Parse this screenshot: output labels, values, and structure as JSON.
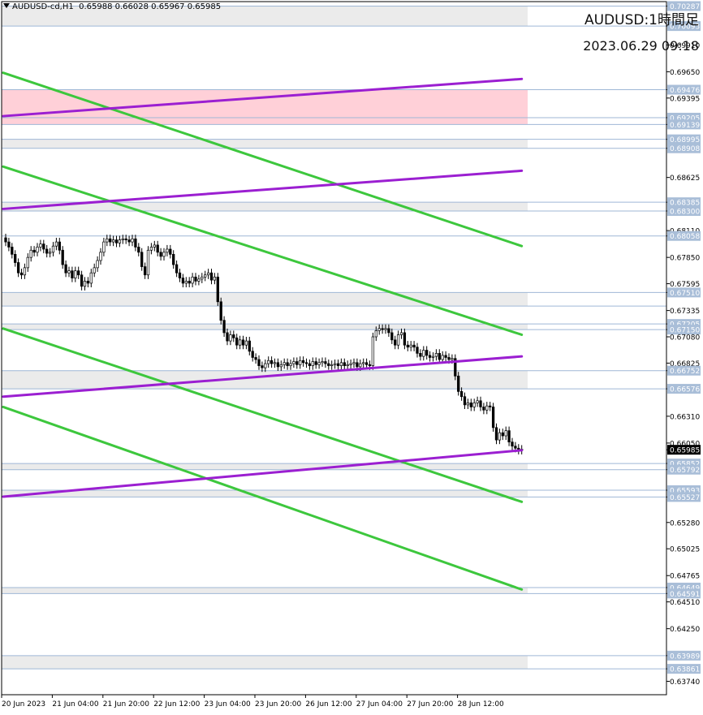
{
  "header": {
    "symbol": "AUDUSD-cd,H1",
    "ohlc": "0.65988 0.66028 0.65967 0.65985"
  },
  "overlay": {
    "title": "AUDUSD:1時間足",
    "datetime": "2023.06.29 09:18"
  },
  "colors": {
    "background": "#ffffff",
    "zone_gray": "#ebebeb",
    "zone_pink": "#ffd0d8",
    "level_line": "#9fb7d6",
    "level_label_bg": "#a9bed8",
    "trend_green": "#3dc73d",
    "trend_purple": "#9b1fd1",
    "bull_candle": "#ffffff",
    "bear_candle": "#000000",
    "current_price_bg": "#000000"
  },
  "chart_data": {
    "type": "candlestick",
    "symbol": "AUDUSD",
    "timeframe": "H1",
    "current_price": "0.65985",
    "price_axis": {
      "range": [
        0.6361,
        0.7033
      ],
      "ticks": [
        "0.70287",
        "0.70093",
        "0.69910",
        "0.69650",
        "0.69476",
        "0.69395",
        "0.69205",
        "0.69139",
        "0.68995",
        "0.68908",
        "0.68625",
        "0.68385",
        "0.68300",
        "0.68110",
        "0.68058",
        "0.67850",
        "0.67595",
        "0.67510",
        "0.67335",
        "0.67205",
        "0.67150",
        "0.67080",
        "0.66825",
        "0.66752",
        "0.66576",
        "0.66310",
        "0.66050",
        "0.65985",
        "0.65852",
        "0.65792",
        "0.65593",
        "0.65527",
        "0.65280",
        "0.65025",
        "0.64765",
        "0.64649",
        "0.64591",
        "0.64510",
        "0.64250",
        "0.63989",
        "0.63861",
        "0.63740"
      ]
    },
    "time_axis": {
      "labels": [
        "20 Jun 2023",
        "21 Jun 04:00",
        "21 Jun 20:00",
        "22 Jun 12:00",
        "23 Jun 04:00",
        "23 Jun 20:00",
        "26 Jun 12:00",
        "27 Jun 04:00",
        "27 Jun 20:00",
        "28 Jun 12:00"
      ]
    },
    "level_lines": [
      0.70287,
      0.70093,
      0.69476,
      0.69205,
      0.69139,
      0.68995,
      0.68908,
      0.68385,
      0.683,
      0.68058,
      0.6751,
      0.67378,
      0.67205,
      0.6715,
      0.66752,
      0.66576,
      0.65852,
      0.65792,
      0.65593,
      0.65527,
      0.64649,
      0.64591,
      0.63989,
      0.63861
    ],
    "zones": [
      {
        "from": 0.70093,
        "to": 0.70287,
        "color": "gray"
      },
      {
        "from": 0.69139,
        "to": 0.69476,
        "color": "pink"
      },
      {
        "from": 0.68908,
        "to": 0.68995,
        "color": "gray"
      },
      {
        "from": 0.683,
        "to": 0.68385,
        "color": "gray"
      },
      {
        "from": 0.67378,
        "to": 0.6751,
        "color": "gray"
      },
      {
        "from": 0.6715,
        "to": 0.67205,
        "color": "gray"
      },
      {
        "from": 0.66576,
        "to": 0.66752,
        "color": "gray"
      },
      {
        "from": 0.65792,
        "to": 0.65852,
        "color": "gray"
      },
      {
        "from": 0.65527,
        "to": 0.65593,
        "color": "gray"
      },
      {
        "from": 0.64591,
        "to": 0.64649,
        "color": "gray"
      },
      {
        "from": 0.63861,
        "to": 0.63989,
        "color": "gray"
      }
    ],
    "trendlines": [
      {
        "color": "green",
        "start": {
          "bar": 0,
          "price": 0.6964
        },
        "end": {
          "bar": 163,
          "price": 0.6796
        }
      },
      {
        "color": "green",
        "start": {
          "bar": 0,
          "price": 0.6873
        },
        "end": {
          "bar": 163,
          "price": 0.671
        }
      },
      {
        "color": "green",
        "start": {
          "bar": 0,
          "price": 0.6716
        },
        "end": {
          "bar": 163,
          "price": 0.6548
        }
      },
      {
        "color": "green",
        "start": {
          "bar": 0,
          "price": 0.664
        },
        "end": {
          "bar": 163,
          "price": 0.6463
        }
      },
      {
        "color": "purple",
        "start": {
          "bar": 0,
          "price": 0.6922
        },
        "end": {
          "bar": 163,
          "price": 0.6958
        }
      },
      {
        "color": "purple",
        "start": {
          "bar": 0,
          "price": 0.6832
        },
        "end": {
          "bar": 163,
          "price": 0.6869
        }
      },
      {
        "color": "purple",
        "start": {
          "bar": 0,
          "price": 0.665
        },
        "end": {
          "bar": 163,
          "price": 0.6689
        }
      },
      {
        "color": "purple",
        "start": {
          "bar": 0,
          "price": 0.6553
        },
        "end": {
          "bar": 163,
          "price": 0.6598
        }
      }
    ],
    "candles_close": [
      0.68,
      0.6795,
      0.6788,
      0.678,
      0.677,
      0.6768,
      0.6775,
      0.6785,
      0.6792,
      0.679,
      0.6795,
      0.6798,
      0.6793,
      0.6789,
      0.679,
      0.6796,
      0.68,
      0.6792,
      0.6778,
      0.677,
      0.6772,
      0.6765,
      0.6772,
      0.6768,
      0.6757,
      0.6762,
      0.676,
      0.677,
      0.6775,
      0.6782,
      0.679,
      0.68,
      0.6803,
      0.68,
      0.6802,
      0.6799,
      0.6802,
      0.6803,
      0.6802,
      0.68,
      0.6803,
      0.6795,
      0.679,
      0.6776,
      0.6768,
      0.6792,
      0.6795,
      0.6797,
      0.679,
      0.6786,
      0.679,
      0.6793,
      0.6788,
      0.6778,
      0.677,
      0.6765,
      0.676,
      0.6762,
      0.676,
      0.6766,
      0.6762,
      0.6764,
      0.6766,
      0.6768,
      0.677,
      0.6763,
      0.6766,
      0.6742,
      0.6724,
      0.6712,
      0.6704,
      0.671,
      0.6707,
      0.67,
      0.6705,
      0.67,
      0.6704,
      0.6694,
      0.6688,
      0.6686,
      0.668,
      0.6678,
      0.6682,
      0.6685,
      0.6682,
      0.6683,
      0.6679,
      0.6681,
      0.6683,
      0.668,
      0.6682,
      0.6684,
      0.6681,
      0.6685,
      0.6683,
      0.6682,
      0.668,
      0.6684,
      0.6681,
      0.6683,
      0.6684,
      0.6682,
      0.668,
      0.6681,
      0.6682,
      0.668,
      0.6683,
      0.668,
      0.6681,
      0.6682,
      0.6683,
      0.6679,
      0.6682,
      0.6683,
      0.6681,
      0.668,
      0.6708,
      0.6714,
      0.6716,
      0.6715,
      0.6716,
      0.6712,
      0.6705,
      0.67,
      0.671,
      0.6712,
      0.67,
      0.6698,
      0.67,
      0.6698,
      0.6692,
      0.6689,
      0.6695,
      0.669,
      0.6688,
      0.6689,
      0.6692,
      0.6686,
      0.669,
      0.6688,
      0.6686,
      0.6687,
      0.667,
      0.6655,
      0.665,
      0.6642,
      0.6644,
      0.664,
      0.6644,
      0.6646,
      0.664,
      0.6637,
      0.6641,
      0.664,
      0.662,
      0.6608,
      0.6615,
      0.6612,
      0.6617,
      0.6606,
      0.6602,
      0.66,
      0.6598,
      0.6599
    ]
  }
}
